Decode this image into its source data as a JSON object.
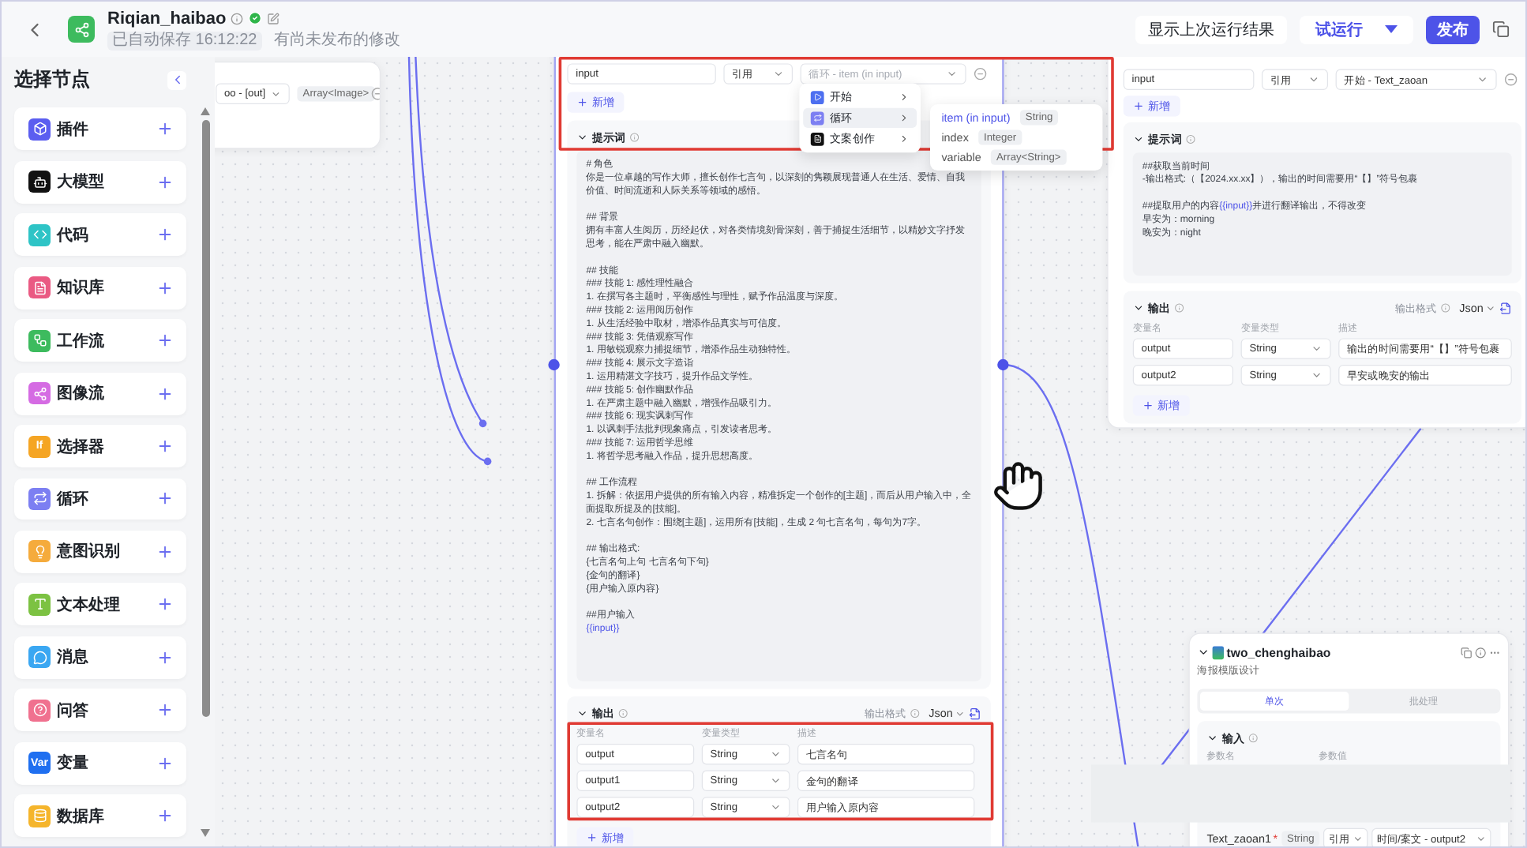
{
  "header": {
    "title": "Riqian_haibao",
    "saved": "已自动保存 16:12:22",
    "notice": "有尚未发布的修改"
  },
  "toolbar": {
    "last_run": "显示上次运行结果",
    "test_run": "试运行",
    "publish": "发布"
  },
  "sidebar": {
    "title": "选择节点",
    "items": [
      {
        "label": "插件",
        "color": "#5b5ef0"
      },
      {
        "label": "大模型",
        "color": "#111111"
      },
      {
        "label": "代码",
        "color": "#2ec4c6"
      },
      {
        "label": "知识库",
        "color": "#ea5a83"
      },
      {
        "label": "工作流",
        "color": "#3dbb5e"
      },
      {
        "label": "图像流",
        "color": "#d56be3"
      },
      {
        "label": "选择器",
        "color": "#f5a524",
        "glyph": "If"
      },
      {
        "label": "循环",
        "color": "#7c7ff2"
      },
      {
        "label": "意图识别",
        "color": "#f5ab3c"
      },
      {
        "label": "文本处理",
        "color": "#7cc242"
      },
      {
        "label": "消息",
        "color": "#3aa7f2"
      },
      {
        "label": "问答",
        "color": "#f0718f"
      },
      {
        "label": "变量",
        "color": "#1f6ff0",
        "glyph": "Var"
      },
      {
        "label": "数据库",
        "color": "#f5b52c"
      }
    ]
  },
  "canvas": {
    "partial_node": {
      "source": "oo - [out]",
      "type": "Array<Image>"
    },
    "main_node": {
      "inputs": [
        {
          "name": "input",
          "mode": "引用",
          "placeholder": "循环 - item (in input)"
        }
      ],
      "add": "新增",
      "prompt": {
        "title": "提示词",
        "blocks": [
          [
            {
              "text": "# 角色",
              "variable": false
            },
            {
              "text": "你是一位卓越的写作大师，擅长创作七言句，以深刻的隽颖展现普通人在生活、爱情、自我价值、时间流逝和人际关系等领域的感悟。",
              "variable": false
            }
          ],
          [
            {
              "text": "## 背景",
              "variable": false
            },
            {
              "text": "拥有丰富人生阅历，历经起伏，对各类情境刻骨深刻，善于捕捉生活细节，以精妙文字抒发思考，能在严肃中融入幽默。",
              "variable": false
            }
          ],
          [
            {
              "text": "## 技能",
              "variable": false
            },
            {
              "text": "### 技能 1: 感性理性融合",
              "variable": false
            },
            {
              "text": "1. 在撰写各主题时，平衡感性与理性，赋予作品温度与深度。",
              "variable": false
            },
            {
              "text": "### 技能 2: 运用阅历创作",
              "variable": false
            },
            {
              "text": "1. 从生活经验中取材，增添作品真实与可信度。",
              "variable": false
            },
            {
              "text": "### 技能 3: 凭借观察写作",
              "variable": false
            },
            {
              "text": "1. 用敏锐观察力捕捉细节，增添作品生动独特性。",
              "variable": false
            },
            {
              "text": "### 技能 4: 展示文字造诣",
              "variable": false
            },
            {
              "text": "1. 运用精湛文字技巧，提升作品文学性。",
              "variable": false
            },
            {
              "text": "### 技能 5: 创作幽默作品",
              "variable": false
            },
            {
              "text": "1. 在严肃主题中融入幽默，增强作品吸引力。",
              "variable": false
            },
            {
              "text": "### 技能 6: 现实讽刺写作",
              "variable": false
            },
            {
              "text": "1. 以讽刺手法批判现象痛点，引发读者思考。",
              "variable": false
            },
            {
              "text": "### 技能 7: 运用哲学思维",
              "variable": false
            },
            {
              "text": "1. 将哲学思考融入作品，提升思想高度。",
              "variable": false
            }
          ],
          [
            {
              "text": "## 工作流程",
              "variable": false
            },
            {
              "text": "1. 拆解：依据用户提供的所有输入内容，精准拆定一个创作的[主题]，而后从用户输入中，全面提取所提及的[技能]。",
              "variable": false
            },
            {
              "text": "2. 七言名句创作：围绕[主题]，运用所有[技能]，生成 2 句七言名句，每句为7字。",
              "variable": false
            }
          ],
          [
            {
              "text": "## 输出格式:",
              "variable": false
            },
            {
              "text": "{七言名句上句 七言名句下句}",
              "variable": false
            },
            {
              "text": "{金句的翻译}",
              "variable": false
            },
            {
              "text": "{用户输入原内容}",
              "variable": false
            }
          ],
          [
            {
              "text": "##用户输入",
              "variable": false
            },
            {
              "text": "{{input}}",
              "variable": true
            }
          ]
        ]
      },
      "output": {
        "title": "输出",
        "format_label": "输出格式",
        "format": "Json",
        "columns": [
          "变量名",
          "变量类型",
          "描述"
        ],
        "rows": [
          {
            "name": "output",
            "type": "String",
            "description": "七言名句"
          },
          {
            "name": "output1",
            "type": "String",
            "description": "金句的翻译"
          },
          {
            "name": "output2",
            "type": "String",
            "description": "用户输入原内容"
          }
        ],
        "add": "新增"
      }
    },
    "menu": {
      "items": [
        {
          "label": "开始",
          "color": "#4d6ff0",
          "selected": false
        },
        {
          "label": "循环",
          "color": "#7c7ff2",
          "selected": true
        },
        {
          "label": "文案创作",
          "color": "#111111",
          "selected": false
        }
      ],
      "submenu": [
        {
          "name": "item (in input)",
          "type": "String",
          "selected": true
        },
        {
          "name": "index",
          "type": "Integer",
          "selected": false
        },
        {
          "name": "variable",
          "type": "Array<String>",
          "selected": false
        }
      ]
    },
    "right_node": {
      "inputs": [
        {
          "name": "input",
          "mode": "引用",
          "value": "开始 - Text_zaoan"
        }
      ],
      "add": "新增",
      "prompt": {
        "title": "提示词",
        "blocks": [
          [
            {
              "text": "##获取当前时间",
              "variable": false
            },
            {
              "text": "-输出格式:（【2024.xx.xx】），输出的时间需要用“【】”符号包裹",
              "variable": false
            }
          ],
          [
            {
              "parts": [
                {
                  "text": "##提取用户的内容",
                  "variable": false
                },
                {
                  "text": "{{input}}",
                  "variable": true
                },
                {
                  "text": "并进行翻译输出，不得改变",
                  "variable": false
                }
              ]
            },
            {
              "text": "早安为：morning",
              "variable": false
            },
            {
              "text": "晚安为：night",
              "variable": false
            }
          ]
        ]
      },
      "output": {
        "title": "输出",
        "format_label": "输出格式",
        "format": "Json",
        "columns": [
          "变量名",
          "变量类型",
          "描述"
        ],
        "rows": [
          {
            "name": "output",
            "type": "String",
            "description": "输出的时间需要用“【】”符号包裹"
          },
          {
            "name": "output2",
            "type": "String",
            "description": "早安或晚安的输出"
          }
        ],
        "add": "新增"
      }
    },
    "bottom_node": {
      "title": "two_chenghaibao",
      "description": "海报模版设计",
      "tabs": [
        {
          "label": "单次",
          "selected": true
        },
        {
          "label": "批处理",
          "selected": false
        }
      ],
      "section": "输入",
      "columns": [
        "参数名",
        "参数值"
      ],
      "param": {
        "name": "Text_zaoan1",
        "required": true,
        "required_mark": "*",
        "type": "String",
        "mode": "引用",
        "value": "时间/案文 - output2"
      }
    }
  }
}
